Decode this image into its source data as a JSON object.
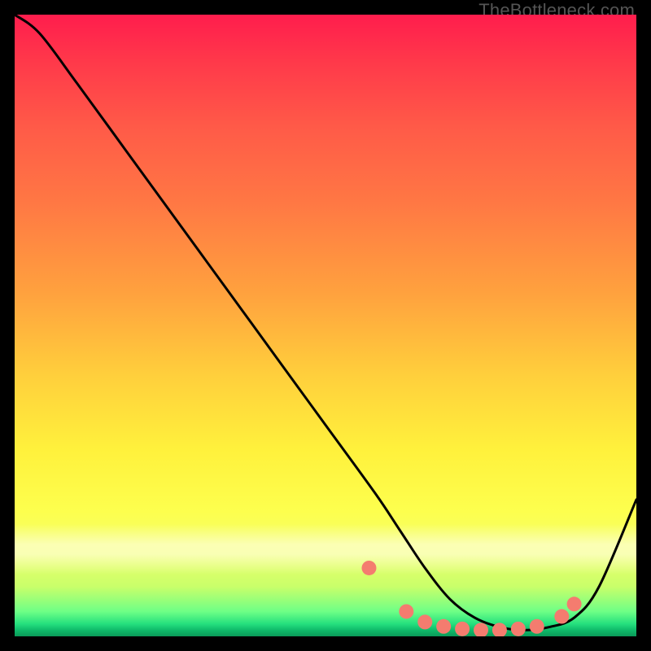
{
  "watermark": "TheBottleneck.com",
  "pale_band": {
    "top_pct": 82,
    "height_pct": 8
  },
  "chart_data": {
    "type": "line",
    "title": "",
    "xlabel": "",
    "ylabel": "",
    "xlim": [
      0,
      100
    ],
    "ylim": [
      0,
      100
    ],
    "grid": false,
    "legend": false,
    "series": [
      {
        "name": "bottleneck-curve",
        "x": [
          0,
          4,
          10,
          18,
          26,
          34,
          42,
          50,
          58,
          62,
          66,
          70,
          74,
          78,
          82,
          86,
          90,
          94,
          100
        ],
        "values": [
          100,
          97,
          89,
          78,
          67,
          56,
          45,
          34,
          23,
          17,
          11,
          6,
          3,
          1.5,
          1,
          1.5,
          3,
          8,
          22
        ]
      }
    ],
    "markers": {
      "name": "dots",
      "color": "#f47c6f",
      "radius_px": 9,
      "x": [
        57,
        63,
        66,
        69,
        72,
        75,
        78,
        81,
        84,
        88,
        90
      ],
      "values": [
        11,
        4,
        2.3,
        1.6,
        1.2,
        1.0,
        1.0,
        1.2,
        1.6,
        3.2,
        5.2
      ]
    }
  }
}
